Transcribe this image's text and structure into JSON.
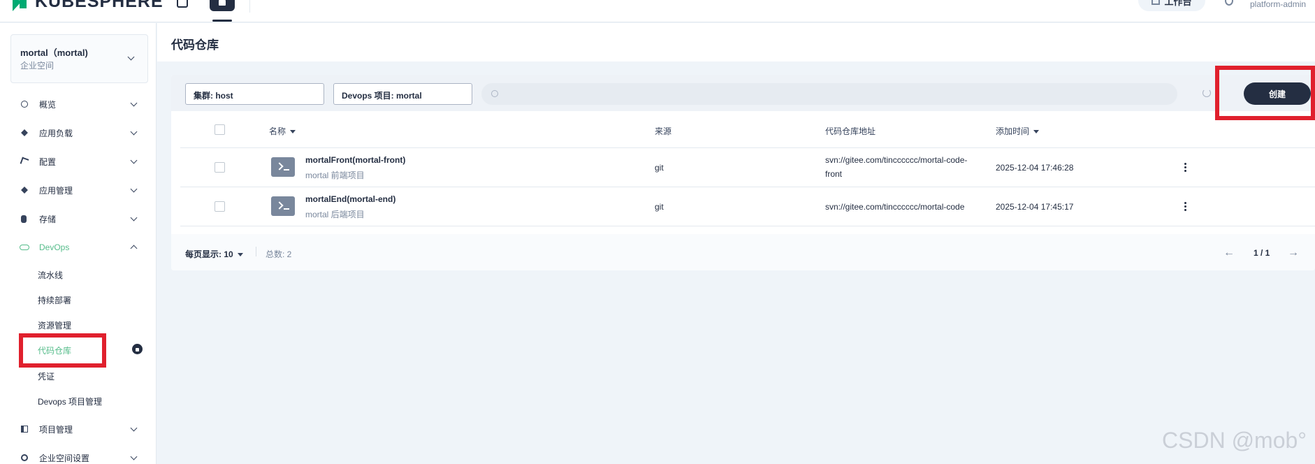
{
  "topbar": {
    "logo": "KUBESPHERE",
    "workbench": "工作台",
    "user": "platform-admin"
  },
  "workspace": {
    "name": "mortal（mortal)",
    "type": "企业空间"
  },
  "nav": {
    "overview": "概览",
    "workloads": "应用负载",
    "config": "配置",
    "app_mgmt": "应用管理",
    "storage": "存储",
    "devops": "DevOps",
    "devops_sub": [
      "流水线",
      "持续部署",
      "资源管理",
      "代码仓库",
      "凭证",
      "Devops 项目管理"
    ],
    "projects": "项目管理",
    "ws_settings": "企业空间设置"
  },
  "page": {
    "title": "代码仓库"
  },
  "toolbar": {
    "cluster_filter": "集群: host",
    "devops_filter": "Devops 项目: mortal",
    "search_placeholder": "",
    "create": "创建"
  },
  "table": {
    "headers": {
      "name": "名称",
      "source": "来源",
      "url": "代码仓库地址",
      "added": "添加时间"
    },
    "rows": [
      {
        "name": "mortalFront(mortal-front)",
        "desc": "mortal 前端项目",
        "source": "git",
        "url_line1": "svn://gitee.com/tincccccc/mortal-code-",
        "url_line2": "front",
        "added": "2025-12-04 17:46:28"
      },
      {
        "name": "mortalEnd(mortal-end)",
        "desc": "mortal 后端项目",
        "source": "git",
        "url_line1": "svn://gitee.com/tincccccc/mortal-code",
        "url_line2": "",
        "added": "2025-12-04 17:45:17"
      }
    ]
  },
  "pagination": {
    "per_page": "每页显示: 10",
    "total": "总数: 2",
    "page": "1 / 1"
  },
  "watermark": "CSDN @mob°",
  "colors": {
    "accent": "#55bc8a",
    "highlight": "#e0202d",
    "dark": "#242e42"
  }
}
